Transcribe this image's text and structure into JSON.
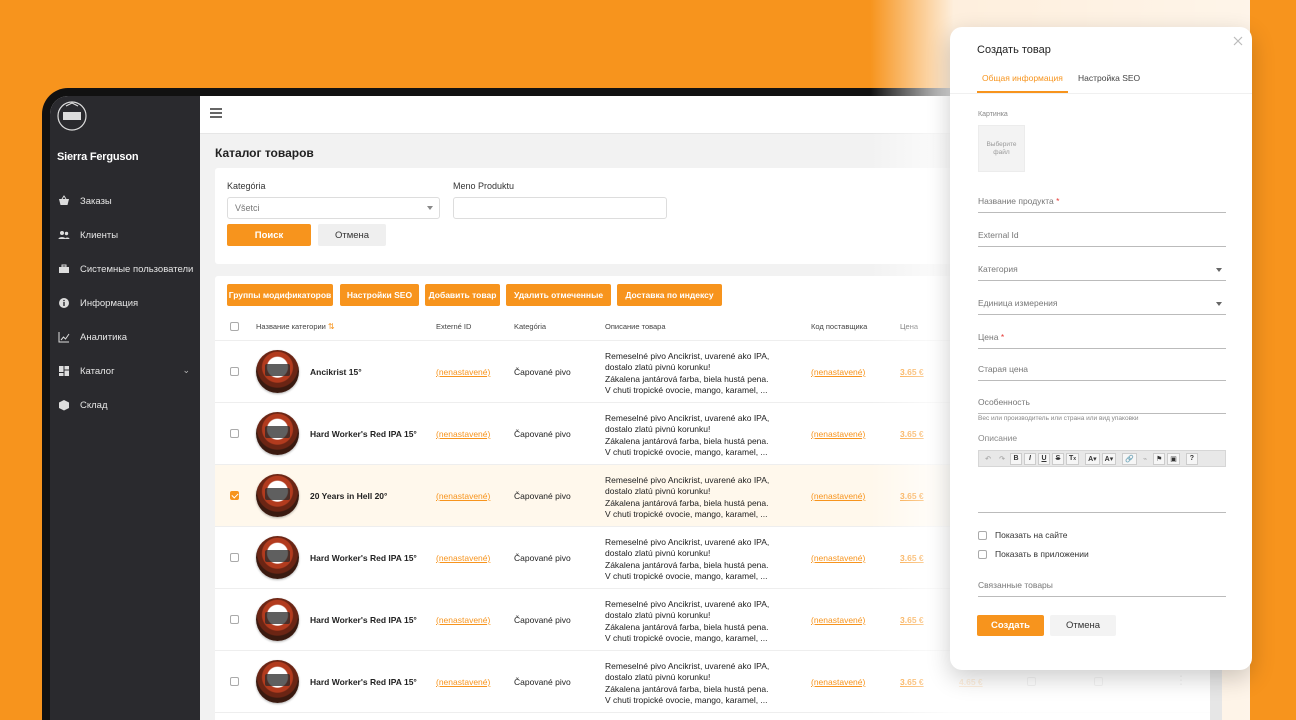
{
  "sidebar": {
    "user": "Sierra Ferguson",
    "items": [
      {
        "label": "Заказы",
        "icon": "basket-icon"
      },
      {
        "label": "Клиенты",
        "icon": "users-icon"
      },
      {
        "label": "Системные пользователи",
        "icon": "briefcase-icon"
      },
      {
        "label": "Информация",
        "icon": "info-icon"
      },
      {
        "label": "Аналитика",
        "icon": "chart-icon"
      },
      {
        "label": "Каталог",
        "icon": "grid-icon"
      },
      {
        "label": "Склад",
        "icon": "box-icon"
      }
    ]
  },
  "page": {
    "title": "Каталог товаров"
  },
  "filters": {
    "category_label": "Kategória",
    "category_value": "Všetci",
    "name_label": "Meno Produktu",
    "search_button": "Поиск",
    "cancel_button": "Отмена"
  },
  "actions": {
    "modifier_groups": "Группы модификаторов",
    "seo_settings": "Настройки SEO",
    "add_product": "Добавить товар",
    "delete_selected": "Удалить отмеченные",
    "delivery_by_index": "Доставка по индексу"
  },
  "table": {
    "headers": {
      "name": "Название категории",
      "external_id": "Externé ID",
      "category": "Kategória",
      "description": "Описание товара",
      "supplier_code": "Код поставщика",
      "price": "Цена"
    },
    "rows": [
      {
        "name": "Ancikrist 15°",
        "external_id": "(nenastavené)",
        "category": "Čapované pivo",
        "desc1": "Remeselné pivo Ancikrist, uvarené ako IPA,",
        "desc2": "dostalo zlatú pivnú korunku!",
        "desc3": "Zákalena jantárová farba, biela hustá pena.",
        "desc4": "V chuti tropické ovocie, mango, karamel, ...",
        "supplier_code": "(nenastavené)",
        "price": "3.65 €",
        "old_price": "",
        "checked": false
      },
      {
        "name": "Hard Worker's Red IPA 15°",
        "external_id": "(nenastavené)",
        "category": "Čapované pivo",
        "desc1": "Remeselné pivo Ancikrist, uvarené ako IPA,",
        "desc2": "dostalo zlatú pivnú korunku!",
        "desc3": "Zákalena jantárová farba, biela hustá pena.",
        "desc4": "V chuti tropické ovocie, mango, karamel, ...",
        "supplier_code": "(nenastavené)",
        "price": "3.65 €",
        "old_price": "",
        "checked": false
      },
      {
        "name": "20 Years in Hell 20°",
        "external_id": "(nenastavené)",
        "category": "Čapované pivo",
        "desc1": "Remeselné pivo Ancikrist, uvarené ako IPA,",
        "desc2": "dostalo zlatú pivnú korunku!",
        "desc3": "Zákalena jantárová farba, biela hustá pena.",
        "desc4": "V chuti tropické ovocie, mango, karamel, ...",
        "supplier_code": "(nenastavené)",
        "price": "3.65 €",
        "old_price": "",
        "checked": true
      },
      {
        "name": "Hard Worker's Red IPA 15°",
        "external_id": "(nenastavené)",
        "category": "Čapované pivo",
        "desc1": "Remeselné pivo Ancikrist, uvarené ako IPA,",
        "desc2": "dostalo zlatú pivnú korunku!",
        "desc3": "Zákalena jantárová farba, biela hustá pena.",
        "desc4": "V chuti tropické ovocie, mango, karamel, ...",
        "supplier_code": "(nenastavené)",
        "price": "3.65 €",
        "old_price": "",
        "checked": false
      },
      {
        "name": "Hard Worker's Red IPA 15°",
        "external_id": "(nenastavené)",
        "category": "Čapované pivo",
        "desc1": "Remeselné pivo Ancikrist, uvarené ako IPA,",
        "desc2": "dostalo zlatú pivnú korunku!",
        "desc3": "Zákalena jantárová farba, biela hustá pena.",
        "desc4": "V chuti tropické ovocie, mango, karamel, ...",
        "supplier_code": "(nenastavené)",
        "price": "3.65 €",
        "old_price": "",
        "checked": false
      },
      {
        "name": "Hard Worker's Red IPA 15°",
        "external_id": "(nenastavené)",
        "category": "Čapované pivo",
        "desc1": "Remeselné pivo Ancikrist, uvarené ako IPA,",
        "desc2": "dostalo zlatú pivnú korunku!",
        "desc3": "Zákalena jantárová farba, biela hustá pena.",
        "desc4": "V chuti tropické ovocie, mango, karamel, ...",
        "supplier_code": "(nenastavené)",
        "price": "3.65 €",
        "old_price": "4.65 €",
        "checked": false
      }
    ]
  },
  "modal": {
    "title": "Создать товар",
    "tab_general": "Общая информация",
    "tab_seo": "Настройка SEO",
    "image_label": "Картинка",
    "choose_file": "Выберите файл",
    "product_name": "Название продукта",
    "required_mark": "*",
    "external_id": "External Id",
    "category": "Категория",
    "unit": "Единица измерения",
    "price": "Цена",
    "old_price": "Старая цена",
    "feature": "Особенность",
    "feature_hint": "Вес или производитель или страна или вид упаковки",
    "description": "Описание",
    "show_on_site": "Показать на сайте",
    "show_in_app": "Показать в приложении",
    "related": "Связанные товары",
    "create_button": "Создать",
    "cancel_button": "Отмена"
  },
  "colors": {
    "accent": "#F7941D",
    "sidebar": "#2a2a2e",
    "background": "#F7941D"
  }
}
